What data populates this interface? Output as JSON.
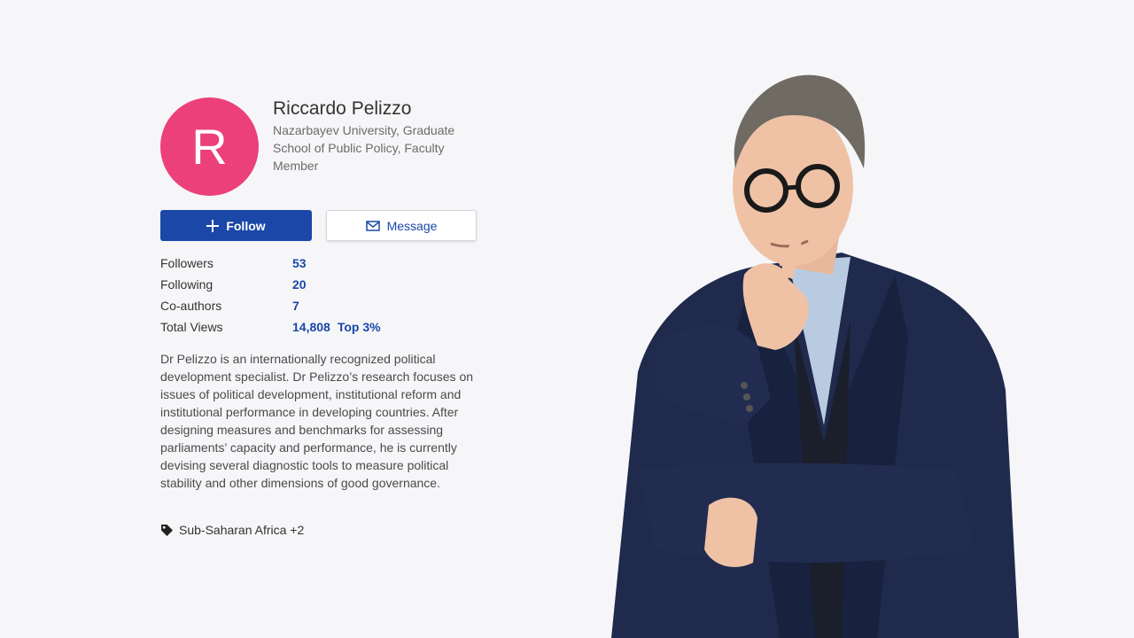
{
  "profile": {
    "avatar_initial": "R",
    "avatar_color": "#ec407a",
    "name": "Riccardo Pelizzo",
    "affiliation": "Nazarbayev University, Graduate School of Public Policy, Faculty Member"
  },
  "actions": {
    "follow_label": "Follow",
    "follow_icon": "plus-icon",
    "message_label": "Message",
    "message_icon": "envelope-icon",
    "accent_color": "#1a47a8"
  },
  "stats": [
    {
      "label": "Followers",
      "value": "53"
    },
    {
      "label": "Following",
      "value": "20"
    },
    {
      "label": "Co-authors",
      "value": "7"
    },
    {
      "label": "Total Views",
      "value": "14,808",
      "badge": "Top 3%"
    }
  ],
  "bio": "Dr Pelizzo is an internationally recognized political development specialist. Dr Pelizzo’s research focuses on issues of political development, institutional reform and institutional performance in developing countries. After designing measures and benchmarks for assessing parliaments’ capacity and performance, he is currently devising several diagnostic tools to measure political stability and other dimensions of good governance.",
  "tags": {
    "icon": "tag-icon",
    "label": "Sub-Saharan Africa +2"
  },
  "photo": {
    "subject": "portrait-photo"
  }
}
